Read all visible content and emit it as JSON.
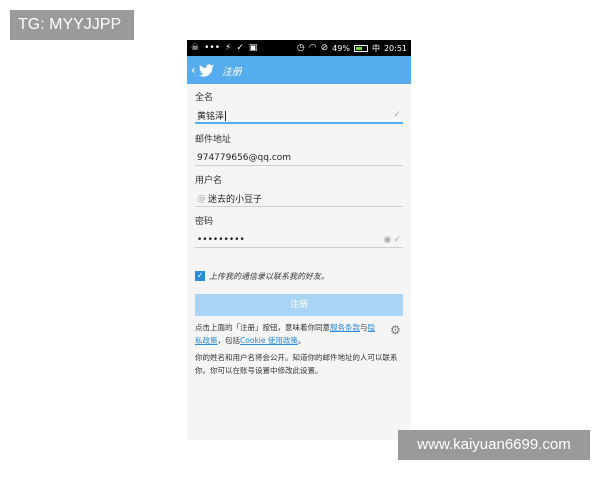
{
  "watermarks": {
    "top_left": "TG: MYYJJPP",
    "bottom_right": "www.kaiyuan6699.com"
  },
  "statusbar": {
    "dots": "•••",
    "battery": "49%",
    "carrier": "中",
    "time": "20:51"
  },
  "actionbar": {
    "title": "注册",
    "back_icon": "chevron-left-icon",
    "logo_icon": "twitter-bird-icon"
  },
  "form": {
    "fullname": {
      "label": "全名",
      "value": "黄铭泽"
    },
    "email": {
      "label": "邮件地址",
      "value": "974779656@qq.com"
    },
    "username": {
      "label": "用户名",
      "prefix": "@",
      "value": "迷去的小豆子"
    },
    "password": {
      "label": "密码",
      "value": "•••••••••"
    }
  },
  "upload_contacts": {
    "checked": true,
    "label": "上传我的通信录以联系我的好友。"
  },
  "register_button": {
    "label": "注册"
  },
  "terms": {
    "part1": "点击上面的「注册」按钮，意味着你同意",
    "link_service": "服务条款",
    "part2": "与",
    "link_privacy": "隐私政策",
    "part3": "，包括",
    "link_cookie": "Cookie 使用政策",
    "part4": "。"
  },
  "privacy_note": "你的姓名和用户名将会公开。知道你的邮件地址的人可以联系你。你可以在账号设置中修改此设置。",
  "colors": {
    "accent": "#55acee",
    "button_disabled": "#a9d4f5",
    "link": "#2a8bd8"
  }
}
